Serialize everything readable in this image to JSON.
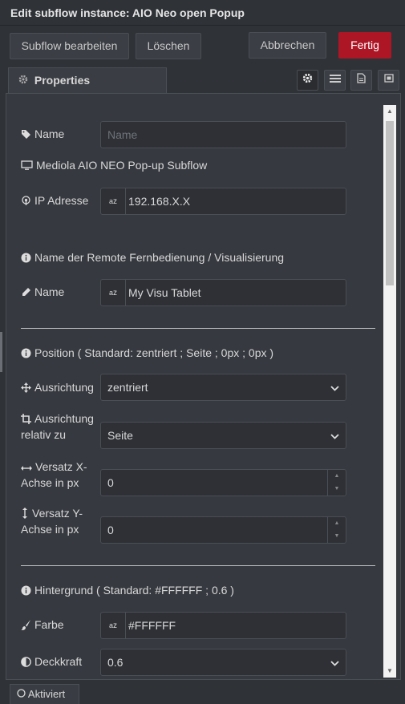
{
  "title": "Edit subflow instance: AIO Neo open Popup",
  "toolbar": {
    "edit_subflow": "Subflow bearbeiten",
    "delete": "Löschen",
    "cancel": "Abbrechen",
    "done": "Fertig"
  },
  "tabs": {
    "properties": "Properties"
  },
  "form": {
    "name_label": "Name",
    "name_placeholder": "Name",
    "subflow_info": "Mediola AIO NEO Pop-up Subflow",
    "ip_label": "IP Adresse",
    "ip_value": "192.168.X.X",
    "remote_section": "Name der Remote Fernbedienung / Visualisierung",
    "remote_name_label": "Name",
    "remote_name_value": "My Visu Tablet",
    "position_section": "Position ( Standard: zentriert ; Seite ; 0px ; 0px )",
    "align_label": "Ausrichtung",
    "align_value": "zentriert",
    "align_rel_label_1": "Ausrichtung",
    "align_rel_label_2": "relativ zu",
    "align_rel_value": "Seite",
    "offset_x_label_1": "Versatz X-",
    "offset_x_label_2": "Achse in px",
    "offset_x_value": "0",
    "offset_y_label_1": "Versatz Y-",
    "offset_y_label_2": "Achse in px",
    "offset_y_value": "0",
    "bg_section": "Hintergrund ( Standard: #FFFFFF ; 0.6 )",
    "color_label": "Farbe",
    "color_value": "#FFFFFF",
    "opacity_label": "Deckkraft",
    "opacity_value": "0.6",
    "type_badge": "az"
  },
  "footer": {
    "active": "Aktiviert"
  },
  "colors": {
    "primary": "#ad1625",
    "background": "#2f3237",
    "panel": "#36393f"
  }
}
